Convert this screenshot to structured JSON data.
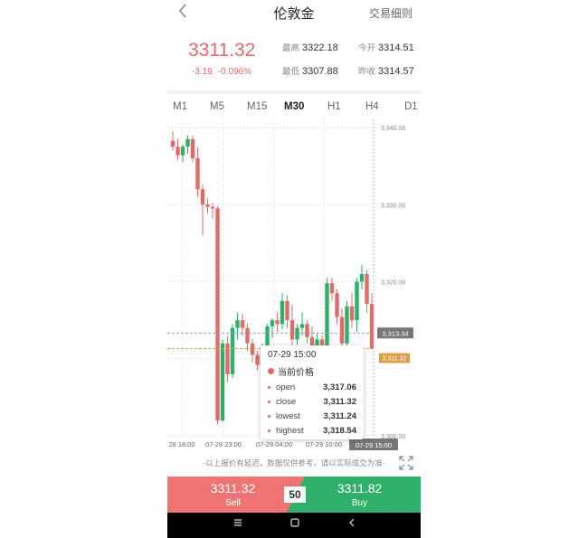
{
  "header": {
    "back_icon": "chevron-left-icon",
    "title": "伦敦金",
    "rules_link": "交易细则"
  },
  "quote": {
    "price": "3311.32",
    "change": "-3.19",
    "change_pct": "-0.096%",
    "high_label": "最高",
    "high": "3322.18",
    "low_label": "最低",
    "low": "3307.88",
    "open_label": "今开",
    "open": "3314.51",
    "prev_close_label": "昨收",
    "prev_close": "3314.57",
    "down_color": "#e06b6b",
    "up_color": "#2fb06a"
  },
  "timeframes": [
    "M1",
    "M5",
    "M15",
    "M30",
    "H1",
    "H4",
    "D1"
  ],
  "active_timeframe": "M30",
  "chart_data": {
    "type": "candlestick",
    "ylim": [
      3300,
      3340
    ],
    "y_ticks": [
      "3,340.00",
      "3,330.00",
      "3,320.00",
      "3,310.00",
      "3,300.00"
    ],
    "x_ticks": [
      "28 18:00",
      "07-28 23:00",
      "07-29 04:00",
      "07-29 10:00",
      "07-29 15:00"
    ],
    "current_price_tag": "3,313.34",
    "last_price_tag": "3,311.32",
    "candles": [
      {
        "o": 3338.3,
        "h": 3339.5,
        "l": 3337.0,
        "c": 3337.5
      },
      {
        "o": 3337.5,
        "h": 3338.5,
        "l": 3335.8,
        "c": 3336.4
      },
      {
        "o": 3336.4,
        "h": 3337.8,
        "l": 3335.5,
        "c": 3337.5
      },
      {
        "o": 3337.5,
        "h": 3339.0,
        "l": 3336.6,
        "c": 3338.5
      },
      {
        "o": 3338.5,
        "h": 3338.9,
        "l": 3335.5,
        "c": 3336.0
      },
      {
        "o": 3336.0,
        "h": 3337.4,
        "l": 3331.0,
        "c": 3332.0
      },
      {
        "o": 3332.0,
        "h": 3332.6,
        "l": 3326.0,
        "c": 3330.0
      },
      {
        "o": 3330.0,
        "h": 3330.8,
        "l": 3328.8,
        "c": 3329.7
      },
      {
        "o": 3329.7,
        "h": 3330.2,
        "l": 3328.2,
        "c": 3329.5
      },
      {
        "o": 3329.5,
        "h": 3329.8,
        "l": 3301.5,
        "c": 3302.0
      },
      {
        "o": 3302.0,
        "h": 3312.5,
        "l": 3301.8,
        "c": 3312.0
      },
      {
        "o": 3312.0,
        "h": 3313.0,
        "l": 3307.0,
        "c": 3308.0
      },
      {
        "o": 3308.0,
        "h": 3314.5,
        "l": 3307.5,
        "c": 3314.0
      },
      {
        "o": 3314.0,
        "h": 3316.0,
        "l": 3312.5,
        "c": 3315.0
      },
      {
        "o": 3315.0,
        "h": 3315.8,
        "l": 3313.0,
        "c": 3314.0
      },
      {
        "o": 3314.0,
        "h": 3314.6,
        "l": 3311.0,
        "c": 3312.0
      },
      {
        "o": 3312.0,
        "h": 3312.6,
        "l": 3309.5,
        "c": 3310.5
      },
      {
        "o": 3310.5,
        "h": 3311.0,
        "l": 3308.5,
        "c": 3309.2
      },
      {
        "o": 3309.2,
        "h": 3312.0,
        "l": 3308.8,
        "c": 3311.5
      },
      {
        "o": 3311.5,
        "h": 3314.5,
        "l": 3310.6,
        "c": 3314.2
      },
      {
        "o": 3314.2,
        "h": 3315.3,
        "l": 3312.7,
        "c": 3315.0
      },
      {
        "o": 3315.0,
        "h": 3316.0,
        "l": 3313.5,
        "c": 3314.5
      },
      {
        "o": 3314.5,
        "h": 3318.5,
        "l": 3313.8,
        "c": 3317.5
      },
      {
        "o": 3317.5,
        "h": 3318.2,
        "l": 3314.0,
        "c": 3315.0
      },
      {
        "o": 3315.0,
        "h": 3317.0,
        "l": 3311.5,
        "c": 3312.5
      },
      {
        "o": 3312.5,
        "h": 3314.5,
        "l": 3311.8,
        "c": 3314.0
      },
      {
        "o": 3314.0,
        "h": 3316.0,
        "l": 3313.0,
        "c": 3314.5
      },
      {
        "o": 3314.5,
        "h": 3315.0,
        "l": 3312.0,
        "c": 3312.8
      },
      {
        "o": 3312.8,
        "h": 3314.2,
        "l": 3309.0,
        "c": 3310.2
      },
      {
        "o": 3310.2,
        "h": 3313.2,
        "l": 3309.8,
        "c": 3312.5
      },
      {
        "o": 3312.5,
        "h": 3313.0,
        "l": 3310.5,
        "c": 3311.4
      },
      {
        "o": 3311.4,
        "h": 3320.5,
        "l": 3311.0,
        "c": 3319.8
      },
      {
        "o": 3319.8,
        "h": 3320.5,
        "l": 3317.5,
        "c": 3318.5
      },
      {
        "o": 3318.5,
        "h": 3319.0,
        "l": 3314.5,
        "c": 3315.4
      },
      {
        "o": 3315.4,
        "h": 3316.5,
        "l": 3311.0,
        "c": 3312.0
      },
      {
        "o": 3312.0,
        "h": 3317.5,
        "l": 3311.2,
        "c": 3316.8
      },
      {
        "o": 3316.8,
        "h": 3318.5,
        "l": 3314.0,
        "c": 3315.0
      },
      {
        "o": 3315.0,
        "h": 3320.5,
        "l": 3313.5,
        "c": 3320.0
      },
      {
        "o": 3320.0,
        "h": 3322.2,
        "l": 3319.0,
        "c": 3321.0
      },
      {
        "o": 3321.0,
        "h": 3321.5,
        "l": 3316.0,
        "c": 3317.1
      },
      {
        "o": 3317.1,
        "h": 3318.5,
        "l": 3311.2,
        "c": 3311.3
      }
    ]
  },
  "tooltip": {
    "time": "07-29 15:00",
    "series": "当前价格",
    "rows": [
      {
        "key": "open",
        "value": "3,317.06"
      },
      {
        "key": "close",
        "value": "3,311.32"
      },
      {
        "key": "lowest",
        "value": "3,311.24"
      },
      {
        "key": "highest",
        "value": "3,318.54"
      }
    ]
  },
  "disclaimer": "-以上报价有延迟，数据仅供参考，请以实际成交为准-",
  "expand_icon": "fullscreen-icon",
  "trade": {
    "sell_price": "3311.32",
    "sell_label": "Sell",
    "spread": "50",
    "buy_price": "3311.82",
    "buy_label": "Buy"
  },
  "navbar": {
    "menu_icon": "menu-icon",
    "home_icon": "home-icon",
    "back_icon": "back-icon"
  }
}
